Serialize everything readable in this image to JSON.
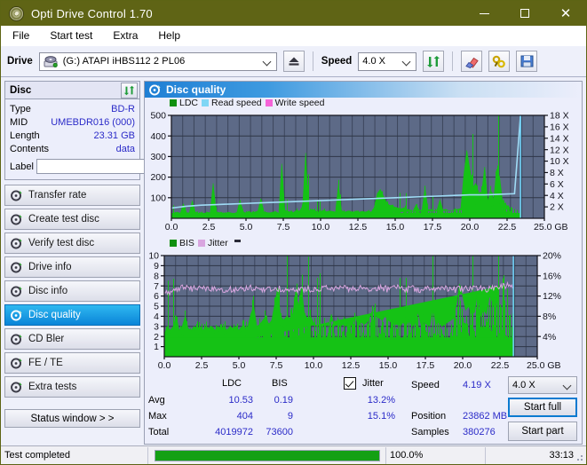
{
  "window": {
    "title": "Opti Drive Control 1.70",
    "app_icon": "disc-icon",
    "minimize": "–",
    "maximize": "□",
    "close": "✕",
    "titlebar_color": "#5f6415"
  },
  "menu": {
    "items": [
      "File",
      "Start test",
      "Extra",
      "Help"
    ]
  },
  "toolbar": {
    "drive_label": "Drive",
    "drive_value": "(G:)  ATAPI iHBS112  2 PL06",
    "eject_icon": "eject-icon",
    "speed_label": "Speed",
    "speed_value": "4.0 X",
    "refresh_icon": "refresh-icon",
    "erase_icon": "eraser-icon",
    "tools_icon": "tools-icon",
    "save_icon": "floppy-save-icon"
  },
  "disc_panel": {
    "title": "Disc",
    "refresh_icon": "refresh-icon",
    "rows": [
      {
        "key": "Type",
        "value": "BD-R"
      },
      {
        "key": "MID",
        "value": "UMEBDR016 (000)"
      },
      {
        "key": "Length",
        "value": "23.31 GB"
      },
      {
        "key": "Contents",
        "value": "data"
      }
    ],
    "label_key": "Label",
    "label_value": "",
    "label_placeholder": "",
    "disc_button_icon": "cd-disc-icon"
  },
  "sidebar": {
    "items": [
      {
        "label": "Transfer rate",
        "icon": "disc-test-icon",
        "selected": false
      },
      {
        "label": "Create test disc",
        "icon": "disc-test-icon",
        "selected": false
      },
      {
        "label": "Verify test disc",
        "icon": "disc-test-icon",
        "selected": false
      },
      {
        "label": "Drive info",
        "icon": "disc-test-icon",
        "selected": false
      },
      {
        "label": "Disc info",
        "icon": "disc-test-icon",
        "selected": false
      },
      {
        "label": "Disc quality",
        "icon": "disc-test-icon",
        "selected": true
      },
      {
        "label": "CD Bler",
        "icon": "disc-test-icon",
        "selected": false
      },
      {
        "label": "FE / TE",
        "icon": "disc-test-icon",
        "selected": false
      },
      {
        "label": "Extra tests",
        "icon": "disc-test-icon",
        "selected": false
      }
    ],
    "status_window": "Status window > >"
  },
  "main": {
    "header_title": "Disc quality",
    "header_icon": "disc-test-icon"
  },
  "stats": {
    "col_ldc": "LDC",
    "col_bis": "BIS",
    "jitter_label": "Jitter",
    "jitter_checked": true,
    "rows": [
      {
        "name": "Avg",
        "ldc": "10.53",
        "bis": "0.19",
        "jitter": "13.2%"
      },
      {
        "name": "Max",
        "ldc": "404",
        "bis": "9",
        "jitter": "15.1%"
      },
      {
        "name": "Total",
        "ldc": "4019972",
        "bis": "73600",
        "jitter": ""
      }
    ],
    "speed_label": "Speed",
    "speed_value": "4.19 X",
    "position_label": "Position",
    "position_value": "23862 MB",
    "samples_label": "Samples",
    "samples_value": "380276",
    "speed_select": "4.0 X",
    "start_full": "Start full",
    "start_part": "Start part"
  },
  "statusbar": {
    "message": "Test completed",
    "progress_text": "100.0%",
    "progress_value": 100,
    "elapsed": "33:13"
  },
  "chart_data": [
    {
      "type": "area",
      "title": "LDC / Read speed / Write speed",
      "xlabel": "GB",
      "ylabel": "LDC",
      "y2label": "X",
      "xlim": [
        0,
        25.0
      ],
      "ylim": [
        0,
        500
      ],
      "y2lim": [
        0,
        18
      ],
      "grid": true,
      "legend_position": "top-left",
      "legend": [
        {
          "name": "LDC",
          "color": "#109010"
        },
        {
          "name": "Read speed",
          "color": "#7fd6f5"
        },
        {
          "name": "Write speed",
          "color": "#f564d8"
        }
      ],
      "xticks": [
        "0.0",
        "2.5",
        "5.0",
        "7.5",
        "10.0",
        "12.5",
        "15.0",
        "17.5",
        "20.0",
        "22.5",
        "25.0 GB"
      ],
      "yticks": [
        "100",
        "200",
        "300",
        "400",
        "500"
      ],
      "y2ticks": [
        "2 X",
        "4 X",
        "6 X",
        "8 X",
        "10 X",
        "12 X",
        "14 X",
        "16 X",
        "18 X"
      ],
      "series": [
        {
          "name": "LDC",
          "color": "#15c215",
          "x": [
            0.0,
            0.2,
            0.4,
            0.6,
            0.8,
            1.0,
            1.2,
            1.4,
            1.6,
            1.8,
            2.0,
            2.2,
            2.4,
            2.6,
            2.8,
            3.0,
            3.2,
            3.4,
            3.6,
            3.8,
            4.0,
            4.2,
            4.4,
            4.6,
            4.8,
            5.0,
            5.2,
            5.4,
            5.6,
            5.8,
            6.0,
            6.2,
            6.4,
            6.6,
            6.8,
            7.0,
            7.2,
            7.4,
            7.6,
            7.8,
            8.0,
            8.2,
            8.4,
            8.6,
            8.8,
            9.0,
            9.2,
            9.4,
            9.6,
            9.8,
            10.0,
            10.2,
            10.4,
            10.6,
            10.8,
            11.0,
            11.2,
            11.4,
            11.6,
            11.8,
            12.0,
            12.2,
            12.4,
            12.6,
            12.8,
            13.0,
            13.2,
            13.4,
            13.6,
            13.8,
            14.0,
            14.2,
            14.4,
            14.6,
            14.8,
            15.0,
            15.2,
            15.4,
            15.6,
            15.8,
            16.0,
            16.2,
            16.4,
            16.6,
            16.8,
            17.0,
            17.2,
            17.4,
            17.6,
            17.8,
            18.0,
            18.2,
            18.4,
            18.6,
            18.8,
            19.0,
            19.2,
            19.4,
            19.6,
            19.8,
            20.0,
            20.2,
            20.4,
            20.6,
            20.8,
            21.0,
            21.2,
            21.4,
            21.6,
            21.8,
            22.0,
            22.2,
            22.4,
            22.6,
            22.8,
            23.0,
            23.2,
            23.4
          ],
          "values": [
            22,
            26,
            30,
            24,
            70,
            28,
            26,
            84,
            30,
            24,
            28,
            22,
            30,
            26,
            170,
            32,
            28,
            26,
            24,
            30,
            26,
            22,
            30,
            90,
            26,
            28,
            34,
            26,
            30,
            36,
            96,
            30,
            28,
            26,
            30,
            32,
            24,
            265,
            40,
            34,
            30,
            28,
            40,
            34,
            60,
            318,
            36,
            44,
            40,
            30,
            34,
            40,
            32,
            36,
            34,
            30,
            165,
            38,
            30,
            34,
            32,
            28,
            36,
            30,
            34,
            30,
            36,
            30,
            52,
            120,
            140,
            110,
            80,
            64,
            60,
            54,
            50,
            46,
            52,
            44,
            40,
            34,
            66,
            40,
            38,
            150,
            40,
            44,
            36,
            40,
            90,
            40,
            44,
            36,
            38,
            42,
            44,
            48,
            210,
            330,
            240,
            150,
            170,
            120,
            126,
            250,
            80,
            140,
            90,
            240,
            200,
            80,
            70,
            45
          ]
        },
        {
          "name": "Read speed",
          "color": "#9fdcf6",
          "x": [
            0.0,
            1.0,
            2.0,
            3.0,
            4.0,
            5.0,
            6.0,
            7.0,
            8.0,
            9.0,
            10.0,
            11.0,
            12.0,
            13.0,
            14.0,
            15.0,
            16.0,
            17.0,
            18.0,
            19.0,
            20.0,
            21.0,
            22.0,
            23.0,
            23.4
          ],
          "values": [
            1.8,
            2.1,
            2.3,
            2.4,
            2.5,
            2.6,
            2.7,
            2.8,
            2.9,
            3.0,
            3.1,
            3.2,
            3.3,
            3.4,
            3.5,
            3.6,
            3.7,
            3.8,
            3.9,
            4.0,
            4.1,
            4.1,
            4.2,
            4.3,
            18.0
          ]
        }
      ]
    },
    {
      "type": "area",
      "title": "BIS / Jitter",
      "xlabel": "GB",
      "ylabel": "BIS",
      "y2label": "%",
      "xlim": [
        0,
        25.0
      ],
      "ylim": [
        0,
        10
      ],
      "y2lim": [
        0,
        20
      ],
      "grid": true,
      "legend_position": "top-left",
      "legend": [
        {
          "name": "BIS",
          "color": "#109010"
        },
        {
          "name": "Jitter",
          "color": "#d9a6e0"
        }
      ],
      "xticks": [
        "0.0",
        "2.5",
        "5.0",
        "7.5",
        "10.0",
        "12.5",
        "15.0",
        "17.5",
        "20.0",
        "22.5",
        "25.0 GB"
      ],
      "yticks": [
        "1",
        "2",
        "3",
        "4",
        "5",
        "6",
        "7",
        "8",
        "9",
        "10"
      ],
      "y2ticks": [
        "4%",
        "8%",
        "12%",
        "16%",
        "20%"
      ],
      "series": [
        {
          "name": "BIS",
          "color": "#15c215",
          "x": [
            0.0,
            0.2,
            0.4,
            0.6,
            0.8,
            1.0,
            1.2,
            1.4,
            1.6,
            1.8,
            2.0,
            2.2,
            2.4,
            2.6,
            2.8,
            3.0,
            3.2,
            3.4,
            3.6,
            3.8,
            4.0,
            4.2,
            4.4,
            4.6,
            4.8,
            5.0,
            5.2,
            5.4,
            5.6,
            5.8,
            6.0,
            6.2,
            6.4,
            6.6,
            6.8,
            7.0,
            7.2,
            7.4,
            7.6,
            7.8,
            8.0,
            8.2,
            8.4,
            8.6,
            8.8,
            9.0,
            9.2,
            9.4,
            9.6,
            9.8,
            10.0,
            10.2,
            10.4,
            10.6,
            10.8,
            11.0,
            11.2,
            11.4,
            11.6,
            11.8,
            12.0,
            12.2,
            12.4,
            12.6,
            12.8,
            13.0,
            13.2,
            13.4,
            13.6,
            13.8,
            14.0,
            14.2,
            14.4,
            14.6,
            14.8,
            15.0,
            15.2,
            15.4,
            15.6,
            15.8,
            16.0,
            16.2,
            16.4,
            16.6,
            16.8,
            17.0,
            17.2,
            17.4,
            17.6,
            17.8,
            18.0,
            18.2,
            18.4,
            18.6,
            18.8,
            19.0,
            19.2,
            19.4,
            19.6,
            19.8,
            20.0,
            20.2,
            20.4,
            20.6,
            20.8,
            21.0,
            21.2,
            21.4,
            21.6,
            21.8,
            22.0,
            22.2,
            22.4,
            22.6,
            22.8,
            23.0,
            23.2,
            23.4
          ],
          "values": [
            2.2,
            3.0,
            2.6,
            3.0,
            4.0,
            2.6,
            3.0,
            4.0,
            2.8,
            2.6,
            3.0,
            2.8,
            3.0,
            2.6,
            3.0,
            2.8,
            3.0,
            2.6,
            3.0,
            2.8,
            3.0,
            2.6,
            3.0,
            2.8,
            3.0,
            2.6,
            3.0,
            2.8,
            3.0,
            4.2,
            5.0,
            3.0,
            3.2,
            3.6,
            4.0,
            3.2,
            3.6,
            5.2,
            6.8,
            4.0,
            3.6,
            4.0,
            3.8,
            4.0,
            6.4,
            5.0,
            6.8,
            4.2,
            3.8,
            4.0,
            3.4,
            3.0,
            3.2,
            3.0,
            3.2,
            3.0,
            4.2,
            3.0,
            3.2,
            3.0,
            3.2,
            3.0,
            3.4,
            3.0,
            4.0,
            3.0,
            3.4,
            3.2,
            3.4,
            4.0,
            4.4,
            4.0,
            3.8,
            3.6,
            4.0,
            3.6,
            3.4,
            3.2,
            3.2,
            3.0,
            3.4,
            3.0,
            3.6,
            3.0,
            3.2,
            4.4,
            3.2,
            3.4,
            3.2,
            3.0,
            4.8,
            3.2,
            3.4,
            3.0,
            3.2,
            3.4,
            3.6,
            3.8,
            5.4,
            7.2,
            6.0,
            4.6,
            5.0,
            4.2,
            4.4,
            6.4,
            4.0,
            4.6,
            4.2,
            6.0,
            5.4,
            4.2,
            6.6,
            7.0
          ]
        },
        {
          "name": "Jitter",
          "color": "#d9a6e0",
          "x": [
            0.0,
            0.3,
            0.6,
            0.9,
            1.2,
            1.5,
            1.8,
            2.1,
            2.4,
            2.7,
            3.0,
            3.3,
            3.6,
            3.9,
            4.2,
            4.5,
            4.8,
            5.1,
            5.4,
            5.7,
            6.0,
            6.3,
            6.6,
            6.9,
            7.2,
            7.5,
            7.8,
            8.1,
            8.4,
            8.7,
            9.0,
            9.3,
            9.6,
            9.9,
            10.2,
            10.5,
            10.8,
            11.1,
            11.4,
            11.7,
            12.0,
            12.3,
            12.6,
            12.9,
            13.2,
            13.5,
            13.8,
            14.1,
            14.4,
            14.7,
            15.0,
            15.3,
            15.6,
            15.9,
            16.2,
            16.5,
            16.8,
            17.1,
            17.4,
            17.7,
            18.0,
            18.3,
            18.6,
            18.9,
            19.2,
            19.5,
            19.8,
            20.1,
            20.4,
            20.7,
            21.0,
            21.3,
            21.6,
            21.9,
            22.2,
            22.5,
            22.8,
            23.1,
            23.4
          ],
          "values": [
            12.4,
            12.6,
            13.0,
            13.6,
            13.8,
            13.6,
            13.4,
            13.5,
            13.4,
            13.3,
            13.4,
            13.5,
            13.3,
            13.4,
            13.2,
            13.4,
            13.3,
            13.4,
            13.3,
            13.5,
            13.6,
            13.5,
            13.4,
            13.6,
            13.4,
            13.3,
            13.5,
            13.4,
            13.6,
            13.5,
            13.3,
            13.5,
            13.4,
            13.3,
            13.5,
            13.4,
            13.6,
            13.5,
            13.3,
            13.4,
            13.6,
            13.5,
            13.3,
            13.5,
            13.7,
            13.6,
            13.5,
            13.4,
            13.6,
            13.5,
            13.3,
            13.4,
            13.6,
            13.5,
            13.3,
            13.4,
            13.5,
            13.3,
            13.4,
            13.6,
            13.5,
            13.3,
            13.5,
            13.6,
            13.4,
            13.3,
            13.5,
            13.4,
            13.6,
            13.5,
            13.3,
            13.4,
            13.2,
            13.4,
            13.5,
            13.6,
            14.0,
            14.4,
            13.6
          ]
        }
      ]
    }
  ]
}
